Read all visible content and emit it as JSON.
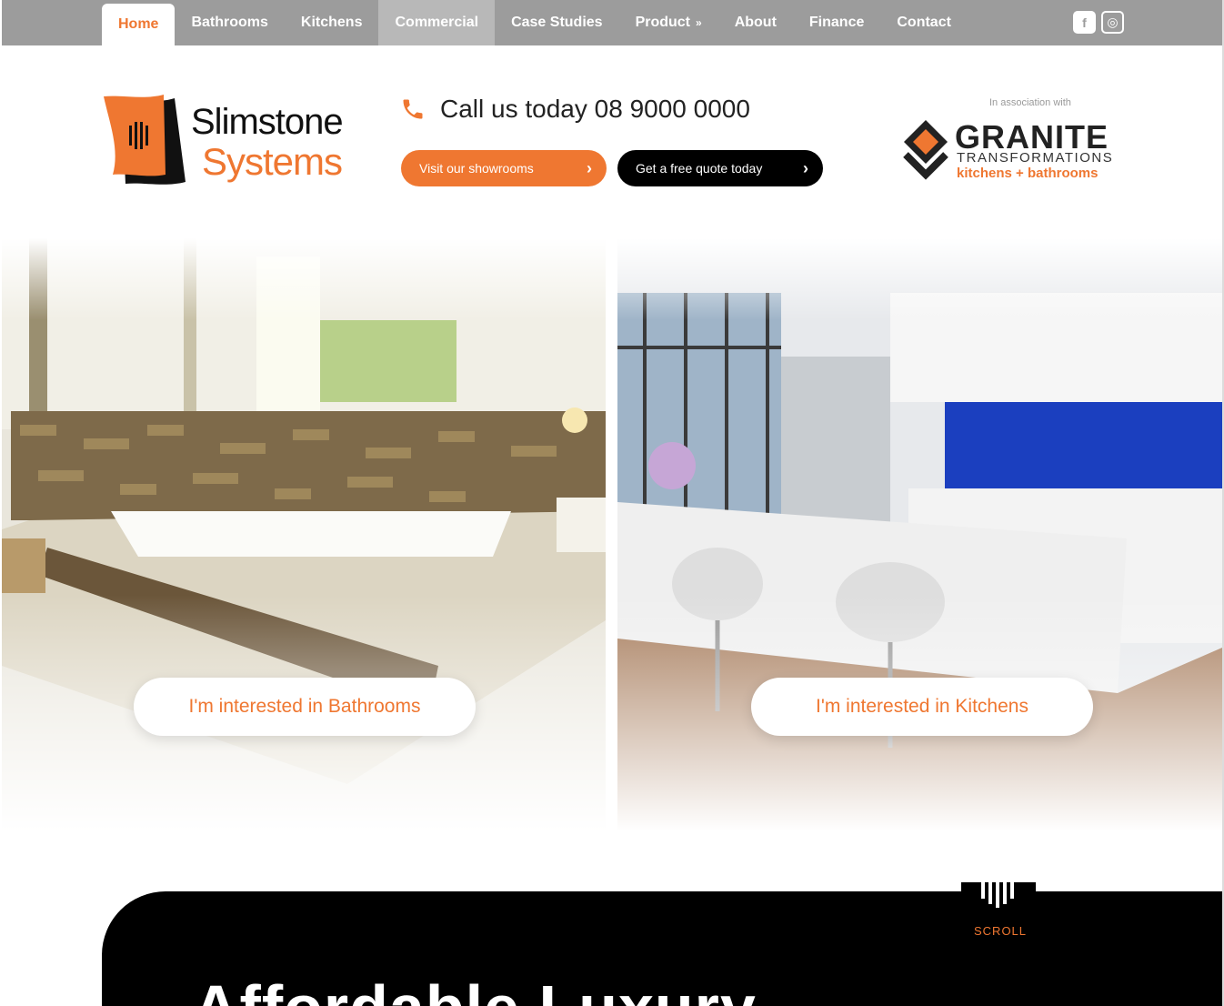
{
  "nav": {
    "items": [
      {
        "label": "Home",
        "state": "active"
      },
      {
        "label": "Bathrooms",
        "state": ""
      },
      {
        "label": "Kitchens",
        "state": ""
      },
      {
        "label": "Commercial",
        "state": "hover"
      },
      {
        "label": "Case Studies",
        "state": ""
      },
      {
        "label": "Product",
        "state": "",
        "dropdown_icon": "double-chevron-down-icon"
      },
      {
        "label": "About",
        "state": ""
      },
      {
        "label": "Finance",
        "state": ""
      },
      {
        "label": "Contact",
        "state": ""
      }
    ],
    "social": [
      {
        "icon": "facebook-icon",
        "glyph": "f"
      },
      {
        "icon": "instagram-icon",
        "glyph": "◎"
      }
    ]
  },
  "header": {
    "logo_line1": "Slimstone",
    "logo_line2": "Systems",
    "call_text": "Call us today 08 9000 0000",
    "buttons": {
      "showrooms": "Visit our showrooms",
      "quote": "Get a free quote today"
    },
    "association": "In association with",
    "partner": {
      "title": "GRANITE",
      "subtitle": "TRANSFORMATIONS",
      "tagline": "kitchens + bathrooms"
    }
  },
  "hero": {
    "bathrooms_cta": "I'm interested in Bathrooms",
    "kitchens_cta": "I'm interested in Kitchens"
  },
  "section": {
    "title": "Affordable Luxury",
    "scroll_label": "SCROLL"
  },
  "colors": {
    "accent": "#ef7731",
    "nav_bg": "#9c9c9c",
    "dark": "#000000"
  }
}
